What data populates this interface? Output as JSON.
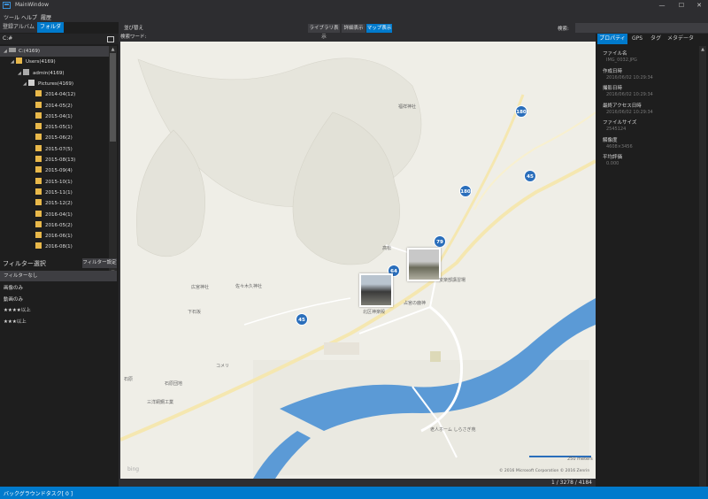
{
  "window": {
    "title": "MainWindow",
    "minimize": "—",
    "maximize": "☐",
    "close": "✕"
  },
  "menu": [
    "ツール",
    "ヘルプ",
    "履歴"
  ],
  "left_tabs": [
    "登録アルバム",
    "フォルダ"
  ],
  "tree": {
    "root": "C:#",
    "items": [
      {
        "label": "C:(4169)",
        "icon": "drive"
      },
      {
        "label": "Users(4169)",
        "icon": "folder"
      },
      {
        "label": "admin(4169)",
        "icon": "user"
      },
      {
        "label": "Pictures(4169)",
        "icon": "pictures"
      },
      {
        "label": "2014-04(12)",
        "icon": "folder"
      },
      {
        "label": "2014-05(2)",
        "icon": "folder"
      },
      {
        "label": "2015-04(1)",
        "icon": "folder"
      },
      {
        "label": "2015-05(1)",
        "icon": "folder"
      },
      {
        "label": "2015-06(2)",
        "icon": "folder"
      },
      {
        "label": "2015-07(5)",
        "icon": "folder"
      },
      {
        "label": "2015-08(13)",
        "icon": "folder"
      },
      {
        "label": "2015-09(4)",
        "icon": "folder"
      },
      {
        "label": "2015-10(1)",
        "icon": "folder"
      },
      {
        "label": "2015-11(1)",
        "icon": "folder"
      },
      {
        "label": "2015-12(2)",
        "icon": "folder"
      },
      {
        "label": "2016-04(1)",
        "icon": "folder"
      },
      {
        "label": "2016-05(2)",
        "icon": "folder"
      },
      {
        "label": "2016-06(1)",
        "icon": "folder"
      },
      {
        "label": "2016-08(1)",
        "icon": "folder"
      }
    ]
  },
  "filter": {
    "title": "フィルター選択",
    "settings": "フィルター設定",
    "items": [
      "フィルターなし",
      "画像のみ",
      "動画のみ",
      "★★★★以上",
      "★★★以上"
    ]
  },
  "toolbar": {
    "sort": "並び替え",
    "keyword": "検索ワード:",
    "views": [
      "ライブラリ表示",
      "詳細表示",
      "マップ表示"
    ],
    "search_label": "検索:",
    "search_value": ""
  },
  "map": {
    "labels": [
      "福祥神社",
      "高松",
      "安楽部講習場",
      "占宮の鹿神",
      "広宮神社",
      "佐々木久神社",
      "下石坂",
      "コメリ",
      "三洋銅鋼工業",
      "石原団地",
      "老人ホーム しらさぎ苑",
      "北区神楽殿",
      "石原"
    ],
    "road_numbers": [
      "180",
      "45",
      "180",
      "79",
      "64",
      "45"
    ],
    "scale": "250 meters",
    "copyright": "© 2016 Microsoft Corporation  © 2016 Zenrin",
    "bing": "bing"
  },
  "status_count": "1 / 3278 / 4184",
  "right_tabs": [
    "プロパティ",
    "GPS",
    "タグ",
    "メタデータ"
  ],
  "properties": [
    {
      "label": "ファイル名",
      "value": "IMG_0032.JPG"
    },
    {
      "label": "作成日時",
      "value": "2016/06/02 10:29:34"
    },
    {
      "label": "撮影日時",
      "value": "2016/06/02 10:29:34"
    },
    {
      "label": "最終アクセス日時",
      "value": "2016/06/02 10:29:34"
    },
    {
      "label": "ファイルサイズ",
      "value": "2545124"
    },
    {
      "label": "解像度",
      "value": "4608×3456"
    },
    {
      "label": "平均評価",
      "value": "0.000"
    }
  ],
  "statusbar": "バックグラウンドタスク[ 0 ]"
}
